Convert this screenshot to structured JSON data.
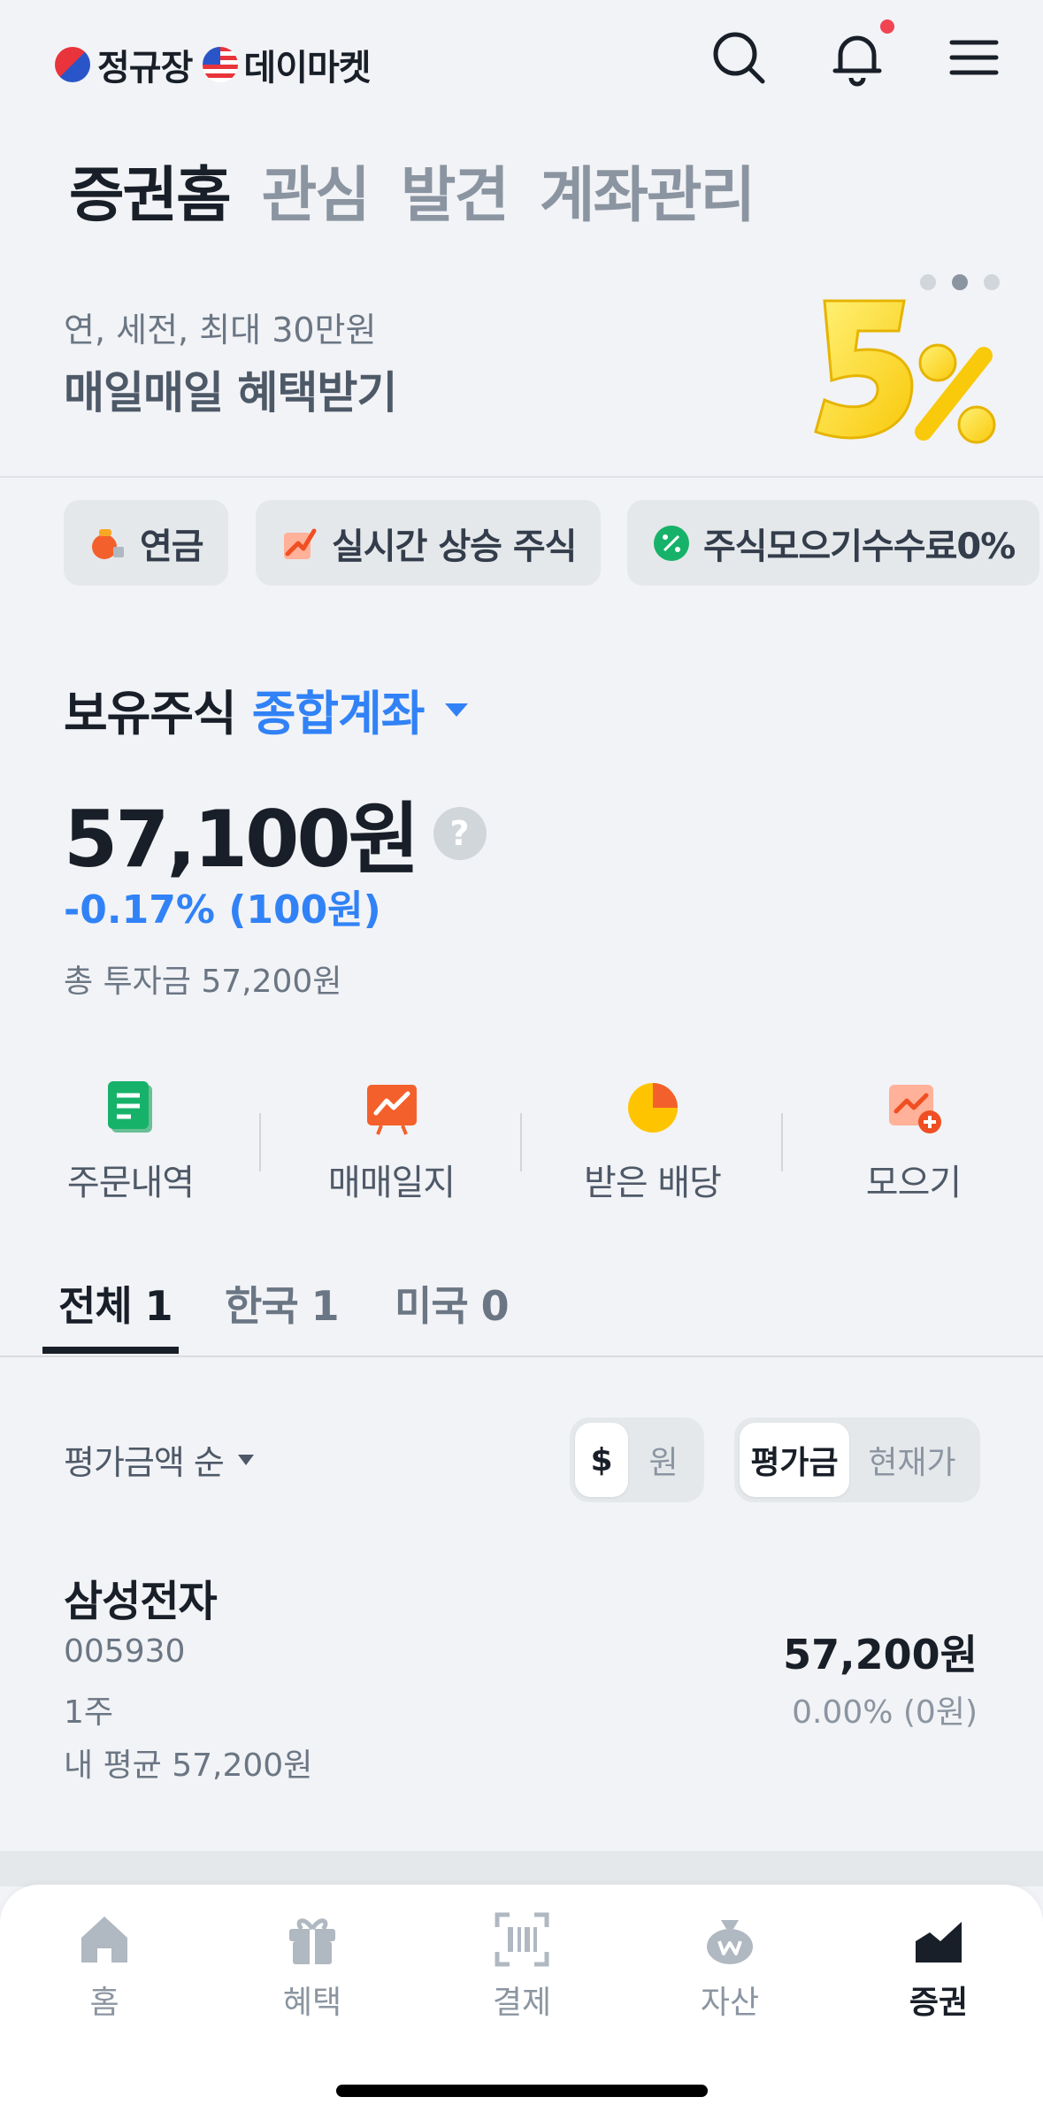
{
  "header": {
    "brand_kr": "정규장",
    "brand_us": "데이마켓",
    "has_notification": true
  },
  "main_tabs": [
    {
      "label": "증권홈",
      "active": true
    },
    {
      "label": "관심",
      "active": false
    },
    {
      "label": "발견",
      "active": false
    },
    {
      "label": "계좌관리",
      "active": false
    }
  ],
  "banner": {
    "subtitle": "연, 세전, 최대 30만원",
    "title": "매일매일 혜택받기",
    "page_count": 3,
    "current_page": 2
  },
  "chips": [
    {
      "label": "연금",
      "icon": "pension-icon"
    },
    {
      "label": "실시간 상승 주식",
      "icon": "trend-up-icon"
    },
    {
      "label": "주식모으기수수료0%",
      "icon": "percent-icon"
    }
  ],
  "holdings": {
    "title": "보유주식",
    "account": "종합계좌",
    "amount": "57,100원",
    "change": "-0.17% (100원)",
    "invested": "총 투자금 57,200원"
  },
  "quick_actions": [
    {
      "label": "주문내역",
      "icon": "order-history-icon"
    },
    {
      "label": "매매일지",
      "icon": "trade-journal-icon"
    },
    {
      "label": "받은 배당",
      "icon": "dividend-pie-icon"
    },
    {
      "label": "모으기",
      "icon": "accumulate-icon"
    }
  ],
  "region_tabs": [
    {
      "label": "전체 1",
      "active": true
    },
    {
      "label": "한국 1",
      "active": false
    },
    {
      "label": "미국 0",
      "active": false
    }
  ],
  "sort": {
    "label": "평가금액 순",
    "currency_options": [
      "$",
      "원"
    ],
    "currency_selected": "$",
    "view_options": [
      "평가금",
      "현재가"
    ],
    "view_selected": "평가금"
  },
  "stock": {
    "name": "삼성전자",
    "code": "005930",
    "quantity": "1주",
    "avg_price": "내 평균 57,200원",
    "value": "57,200원",
    "change": "0.00% (0원)"
  },
  "bottom_nav": [
    {
      "label": "홈",
      "icon": "home-icon",
      "active": false
    },
    {
      "label": "혜택",
      "icon": "gift-icon",
      "active": false
    },
    {
      "label": "결제",
      "icon": "barcode-scan-icon",
      "active": false
    },
    {
      "label": "자산",
      "icon": "money-bag-icon",
      "active": false
    },
    {
      "label": "증권",
      "icon": "stock-chart-icon",
      "active": true
    }
  ],
  "colors": {
    "accent_blue": "#3182f6",
    "text_primary": "#191f28",
    "text_secondary": "#6b7684",
    "background": "#f2f3f6",
    "notification_red": "#f04452"
  }
}
